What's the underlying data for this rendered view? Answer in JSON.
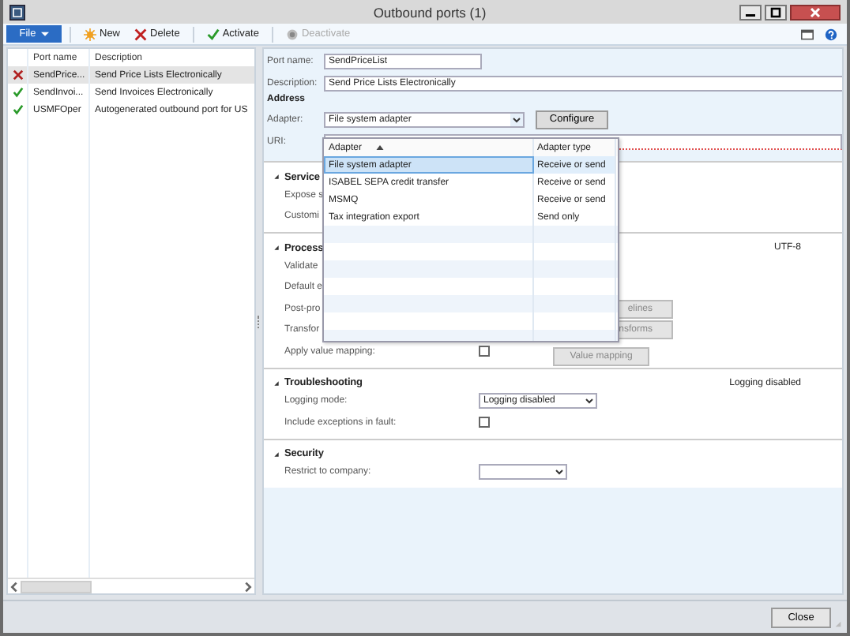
{
  "window": {
    "title": "Outbound ports (1)"
  },
  "toolbar": {
    "file_menu": "File",
    "buttons": [
      {
        "kind": "new",
        "label": "New",
        "disabled": false
      },
      {
        "kind": "delete",
        "label": "Delete",
        "disabled": false
      },
      {
        "kind": "activate",
        "label": "Activate",
        "disabled": false
      },
      {
        "kind": "deactivate",
        "label": "Deactivate",
        "disabled": true
      }
    ]
  },
  "ports": {
    "columns": [
      "Port name",
      "Description"
    ],
    "rows": [
      {
        "kind": "inactive",
        "port_name": "SendPrice...",
        "description": "Send Price Lists Electronically",
        "selected": true
      },
      {
        "kind": "active",
        "port_name": "SendInvoi...",
        "description": "Send Invoices Electronically",
        "selected": false
      },
      {
        "kind": "active",
        "port_name": "USMFOper",
        "description": "Autogenerated outbound port for US",
        "selected": false
      }
    ]
  },
  "details": {
    "port_name_label": "Port name:",
    "port_name": "SendPriceList",
    "description_label": "Description:",
    "description": "Send Price Lists Electronically",
    "address_heading": "Address",
    "adapter_label": "Adapter:",
    "adapter_value": "File system adapter",
    "configure_button": "Configure",
    "uri_label": "URI:",
    "sections": [
      {
        "title": "Service",
        "expanded": true,
        "fields": [
          {
            "kind": "label",
            "label": "Expose s"
          },
          {
            "kind": "label",
            "label": "Customi"
          }
        ]
      },
      {
        "title": "Process",
        "expanded": true,
        "summary": "UTF-8",
        "fields": [
          {
            "kind": "label",
            "label": "Validate"
          },
          {
            "kind": "label",
            "label": "Default e"
          },
          {
            "kind": "button",
            "label": "Post-pro",
            "button": "elines"
          },
          {
            "kind": "button",
            "label": "Transfor",
            "button": "nsforms"
          },
          {
            "kind": "checkbox",
            "label": "Apply value mapping:",
            "checked": false,
            "button": "Value mapping"
          }
        ]
      },
      {
        "title": "Troubleshooting",
        "expanded": true,
        "summary": "Logging disabled",
        "fields": [
          {
            "kind": "combo",
            "label": "Logging mode:",
            "value": "Logging disabled"
          },
          {
            "kind": "checkbox",
            "label": "Include exceptions in fault:",
            "checked": false
          }
        ]
      },
      {
        "title": "Security",
        "expanded": true,
        "fields": [
          {
            "kind": "combo",
            "label": "Restrict to company:"
          }
        ]
      }
    ]
  },
  "adapter_dropdown": {
    "columns": [
      "Adapter",
      "Adapter type"
    ],
    "rows": [
      {
        "adapter": "File system adapter",
        "adapter_type": "Receive or send",
        "selected": true
      },
      {
        "adapter": "ISABEL SEPA credit transfer",
        "adapter_type": "Receive or send",
        "selected": false
      },
      {
        "adapter": "MSMQ",
        "adapter_type": "Receive or send",
        "selected": false
      },
      {
        "adapter": "Tax integration export",
        "adapter_type": "Send only",
        "selected": false
      }
    ]
  },
  "footer": {
    "close_button": "Close"
  }
}
